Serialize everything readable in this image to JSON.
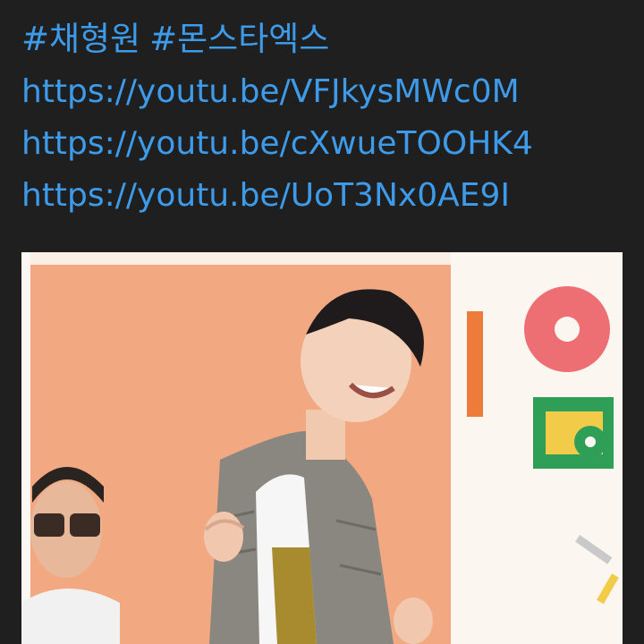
{
  "colors": {
    "background": "#1f1f1f",
    "link": "#3d9bea"
  },
  "post": {
    "hashtags": [
      "#채형원",
      "#몬스타엑스"
    ],
    "links": [
      "https://youtu.be/VFJkysMWc0M",
      "https://youtu.be/cXwueTOOHK4",
      "https://youtu.be/UoT3Nx0AE9I"
    ]
  },
  "media": {
    "type": "gif-preview"
  }
}
